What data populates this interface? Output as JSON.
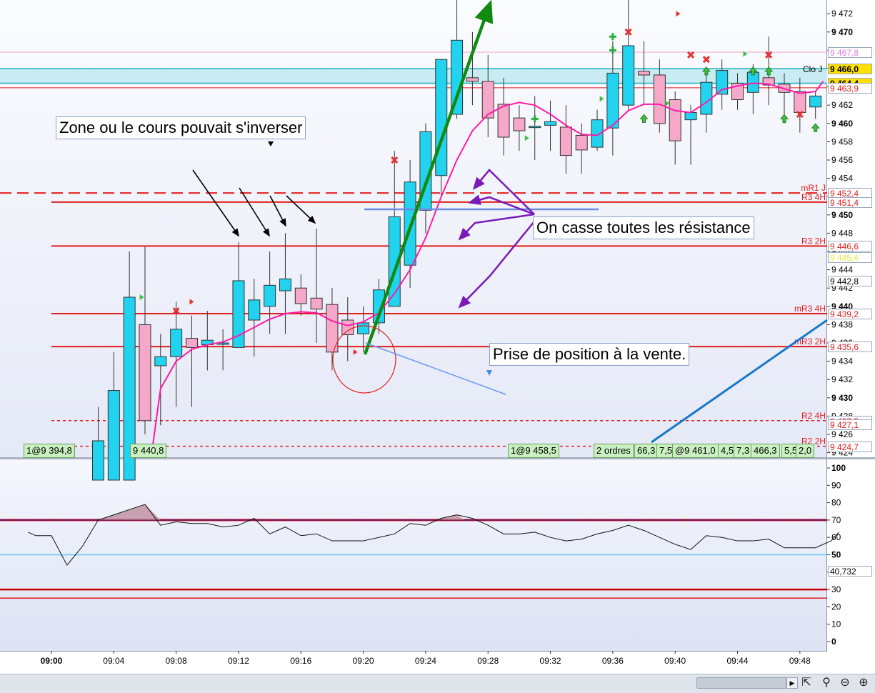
{
  "chart_data": [
    {
      "type": "candlestick",
      "panel": "price",
      "y_ticks": [
        "9 472",
        "9 470",
        "9 468",
        "9 466",
        "9 464",
        "9 462",
        "9 460",
        "9 458",
        "9 456",
        "9 454",
        "9 452",
        "9 450",
        "9 448",
        "9 446",
        "9 444",
        "9 442",
        "9 440",
        "9 438",
        "9 436",
        "9 434",
        "9 432",
        "9 430",
        "9 428",
        "9 426",
        "9 424"
      ],
      "bold_ticks": [
        9470,
        9460,
        9450,
        9440,
        9430
      ],
      "ylim": [
        9423.5,
        9473.5
      ],
      "x_ticks": [
        "09:00",
        "09:04",
        "09:08",
        "09:12",
        "09:16",
        "09:20",
        "09:24",
        "09:28",
        "09:32",
        "09:36",
        "09:40",
        "09:44",
        "09:48"
      ],
      "candles": [
        {
          "t": "09:03",
          "o": 9421.0,
          "h": 9429.0,
          "l": 9421.0,
          "c": 9425.3
        },
        {
          "t": "09:04",
          "o": 9421.0,
          "h": 9435.0,
          "l": 9421.0,
          "c": 9430.8
        },
        {
          "t": "09:05",
          "o": 9421.0,
          "h": 9446.0,
          "l": 9421.0,
          "c": 9441.0
        },
        {
          "t": "09:06",
          "o": 9438.0,
          "h": 9446.5,
          "l": 9426.0,
          "c": 9427.5
        },
        {
          "t": "09:07",
          "o": 9433.5,
          "h": 9437.0,
          "l": 9427.0,
          "c": 9434.5
        },
        {
          "t": "09:08",
          "o": 9434.5,
          "h": 9440.5,
          "l": 9429.0,
          "c": 9437.5
        },
        {
          "t": "09:09",
          "o": 9436.5,
          "h": 9439.0,
          "l": 9429.0,
          "c": 9435.5
        },
        {
          "t": "09:10",
          "o": 9435.8,
          "h": 9439.5,
          "l": 9433.0,
          "c": 9436.3
        },
        {
          "t": "09:11",
          "o": 9436.0,
          "h": 9437.5,
          "l": 9433.0,
          "c": 9436.0
        },
        {
          "t": "09:12",
          "o": 9435.5,
          "h": 9447.0,
          "l": 9435.5,
          "c": 9442.8
        },
        {
          "t": "09:13",
          "o": 9438.5,
          "h": 9443.0,
          "l": 9434.5,
          "c": 9440.7
        },
        {
          "t": "09:14",
          "o": 9440.0,
          "h": 9446.0,
          "l": 9437.0,
          "c": 9442.3
        },
        {
          "t": "09:15",
          "o": 9441.7,
          "h": 9448.0,
          "l": 9437.0,
          "c": 9443.0
        },
        {
          "t": "09:16",
          "o": 9442.0,
          "h": 9443.5,
          "l": 9439.0,
          "c": 9440.3
        },
        {
          "t": "09:17",
          "o": 9440.9,
          "h": 9448.5,
          "l": 9436.0,
          "c": 9439.7
        },
        {
          "t": "09:18",
          "o": 9440.2,
          "h": 9442.0,
          "l": 9433.0,
          "c": 9435.0
        },
        {
          "t": "09:19",
          "o": 9438.5,
          "h": 9441.0,
          "l": 9434.0,
          "c": 9436.9
        },
        {
          "t": "09:20",
          "o": 9437.0,
          "h": 9440.0,
          "l": 9435.0,
          "c": 9438.2
        },
        {
          "t": "09:21",
          "o": 9438.2,
          "h": 9443.0,
          "l": 9437.0,
          "c": 9441.8
        },
        {
          "t": "09:22",
          "o": 9440.0,
          "h": 9457.0,
          "l": 9440.0,
          "c": 9449.8
        },
        {
          "t": "09:23",
          "o": 9444.5,
          "h": 9456.0,
          "l": 9442.0,
          "c": 9453.6
        },
        {
          "t": "09:24",
          "o": 9450.5,
          "h": 9460.0,
          "l": 9448.0,
          "c": 9459.1
        },
        {
          "t": "09:25",
          "o": 9454.3,
          "h": 9466.0,
          "l": 9452.0,
          "c": 9467.0
        },
        {
          "t": "09:26",
          "o": 9461.0,
          "h": 9476.0,
          "l": 9460.5,
          "c": 9469.1
        },
        {
          "t": "09:27",
          "o": 9465.0,
          "h": 9470.0,
          "l": 9462.0,
          "c": 9464.6
        },
        {
          "t": "09:28",
          "o": 9464.6,
          "h": 9467.5,
          "l": 9458.5,
          "c": 9460.6
        },
        {
          "t": "09:29",
          "o": 9462.1,
          "h": 9465.0,
          "l": 9456.5,
          "c": 9458.5
        },
        {
          "t": "09:30",
          "o": 9460.6,
          "h": 9462.0,
          "l": 9457.0,
          "c": 9459.2
        },
        {
          "t": "09:31",
          "o": 9459.7,
          "h": 9463.0,
          "l": 9456.0,
          "c": 9459.7
        },
        {
          "t": "09:32",
          "o": 9459.8,
          "h": 9462.5,
          "l": 9457.0,
          "c": 9460.2
        },
        {
          "t": "09:33",
          "o": 9459.6,
          "h": 9462.0,
          "l": 9454.5,
          "c": 9456.5
        },
        {
          "t": "09:34",
          "o": 9458.7,
          "h": 9460.0,
          "l": 9454.5,
          "c": 9457.1
        },
        {
          "t": "09:35",
          "o": 9457.4,
          "h": 9461.5,
          "l": 9457.0,
          "c": 9460.4
        },
        {
          "t": "09:36",
          "o": 9459.5,
          "h": 9469.0,
          "l": 9456.5,
          "c": 9465.5
        },
        {
          "t": "09:37",
          "o": 9462.0,
          "h": 9474.0,
          "l": 9461.5,
          "c": 9468.5
        },
        {
          "t": "09:38",
          "o": 9465.7,
          "h": 9469.0,
          "l": 9462.0,
          "c": 9465.3
        },
        {
          "t": "09:39",
          "o": 9465.3,
          "h": 9467.0,
          "l": 9459.0,
          "c": 9460.0
        },
        {
          "t": "09:40",
          "o": 9462.6,
          "h": 9463.5,
          "l": 9455.5,
          "c": 9458.1
        },
        {
          "t": "09:41",
          "o": 9460.4,
          "h": 9462.0,
          "l": 9455.5,
          "c": 9461.2
        },
        {
          "t": "09:42",
          "o": 9461.0,
          "h": 9466.0,
          "l": 9459.0,
          "c": 9464.5
        },
        {
          "t": "09:43",
          "o": 9463.2,
          "h": 9467.0,
          "l": 9461.5,
          "c": 9465.8
        },
        {
          "t": "09:44",
          "o": 9464.4,
          "h": 9465.5,
          "l": 9461.5,
          "c": 9462.6
        },
        {
          "t": "09:45",
          "o": 9463.4,
          "h": 9466.5,
          "l": 9461.0,
          "c": 9465.6
        },
        {
          "t": "09:46",
          "o": 9465.0,
          "h": 9469.5,
          "l": 9462.0,
          "c": 9464.2
        },
        {
          "t": "09:47",
          "o": 9464.3,
          "h": 9465.5,
          "l": 9460.0,
          "c": 9463.4
        },
        {
          "t": "09:48",
          "o": 9463.5,
          "h": 9465.0,
          "l": 9459.0,
          "c": 9461.2
        },
        {
          "t": "09:49",
          "o": 9461.8,
          "h": 9463.5,
          "l": 9460.5,
          "c": 9463.0
        }
      ],
      "moving_average": [
        {
          "t": "09:06.5",
          "v": 9424.8
        },
        {
          "t": "09:07",
          "v": 9431.0
        },
        {
          "t": "09:08",
          "v": 9434.0
        },
        {
          "t": "09:09",
          "v": 9435.3
        },
        {
          "t": "09:10",
          "v": 9435.8
        },
        {
          "t": "09:11",
          "v": 9436.1
        },
        {
          "t": "09:12",
          "v": 9436.8
        },
        {
          "t": "09:13",
          "v": 9437.7
        },
        {
          "t": "09:14",
          "v": 9438.6
        },
        {
          "t": "09:15",
          "v": 9439.2
        },
        {
          "t": "09:16",
          "v": 9439.4
        },
        {
          "t": "09:17",
          "v": 9439.3
        },
        {
          "t": "09:18",
          "v": 9438.4
        },
        {
          "t": "09:19",
          "v": 9437.9
        },
        {
          "t": "09:20",
          "v": 9438.3
        },
        {
          "t": "09:21",
          "v": 9439.3
        },
        {
          "t": "09:22",
          "v": 9441.4
        },
        {
          "t": "09:23",
          "v": 9444.0
        },
        {
          "t": "09:24",
          "v": 9447.5
        },
        {
          "t": "09:25",
          "v": 9452.0
        },
        {
          "t": "09:26",
          "v": 9456.0
        },
        {
          "t": "09:27",
          "v": 9459.2
        },
        {
          "t": "09:28",
          "v": 9461.0
        },
        {
          "t": "09:29",
          "v": 9461.9
        },
        {
          "t": "09:30",
          "v": 9462.3
        },
        {
          "t": "09:31",
          "v": 9462.0
        },
        {
          "t": "09:32",
          "v": 9461.0
        },
        {
          "t": "09:33",
          "v": 9459.8
        },
        {
          "t": "09:34",
          "v": 9458.8
        },
        {
          "t": "09:35",
          "v": 9458.7
        },
        {
          "t": "09:36",
          "v": 9459.8
        },
        {
          "t": "09:37",
          "v": 9461.4
        },
        {
          "t": "09:38",
          "v": 9462.1
        },
        {
          "t": "09:39",
          "v": 9462.1
        },
        {
          "t": "09:40",
          "v": 9461.4
        },
        {
          "t": "09:41",
          "v": 9461.2
        },
        {
          "t": "09:42",
          "v": 9462.3
        },
        {
          "t": "09:43",
          "v": 9463.7
        },
        {
          "t": "09:44",
          "v": 9464.1
        },
        {
          "t": "09:45",
          "v": 9464.4
        },
        {
          "t": "09:46",
          "v": 9464.3
        },
        {
          "t": "09:47",
          "v": 9463.8
        },
        {
          "t": "09:48",
          "v": 9463.3
        },
        {
          "t": "09:49",
          "v": 9463.5
        },
        {
          "t": "09:49.5",
          "v": 9464.6
        }
      ],
      "levels": [
        {
          "label": "mR1 J",
          "tag": "9 452,4",
          "value": 9452.4,
          "style": "dashed",
          "color": "#e41c1c"
        },
        {
          "label": "R3 4H",
          "tag": "9 451,4",
          "value": 9451.4,
          "style": "solid",
          "color": "#e41c1c"
        },
        {
          "label": "R3 2H",
          "tag": "9 446,6",
          "value": 9446.6,
          "style": "solid",
          "color": "#e41c1c"
        },
        {
          "label": "mR3 4H",
          "tag": "9 439,2",
          "value": 9439.2,
          "style": "solid",
          "color": "#e41c1c"
        },
        {
          "label": "mR3 2H",
          "tag": "9 435,6",
          "value": 9435.6,
          "style": "solid",
          "color": "#e41c1c"
        },
        {
          "label": "R2 4H",
          "tag": "9 427,5",
          "value": 9427.5,
          "style": "dotted",
          "color": "#e41c1c"
        },
        {
          "label": "R2 2H",
          "tag": "9 424,7",
          "value": 9424.7,
          "style": "dotted",
          "color": "#e41c1c"
        },
        {
          "label": "",
          "tag": "9 427,1",
          "value": 9427.1,
          "style": "none",
          "color": "#e41c1c"
        }
      ],
      "top_bands": [
        {
          "label": "Clo J",
          "tag": "9 466,0",
          "value": 9466.0,
          "color": "#20b0c0",
          "tag_bg": "#ffe000"
        },
        {
          "label": "",
          "tag": "9 464,4",
          "value": 9464.4,
          "color": "#20b0c0",
          "tag_bg": "#ffe000"
        },
        {
          "label": "",
          "tag": "9 463,9",
          "value": 9463.9,
          "color": "#e41c1c",
          "tag_bg": "#ffffff"
        },
        {
          "label": "",
          "tag": "9 467,8",
          "value": 9467.8,
          "color": "#e080e0",
          "tag_bg": "#ffffff"
        },
        {
          "label": "",
          "tag": "9 445,4",
          "value": 9445.4,
          "color": "#e8e840",
          "tag_bg": "#ffffff"
        },
        {
          "label": "",
          "tag": "9 442,8",
          "value": 9442.8,
          "color": "#555555",
          "tag_bg": "#ffffff"
        }
      ],
      "annotations": [
        {
          "key": "zone",
          "text": "Zone ou le cours pouvait s'inverser"
        },
        {
          "key": "casse",
          "text": "On casse toutes les résistance"
        },
        {
          "key": "vente",
          "text": "Prise de position à la vente."
        }
      ],
      "order_boxes": [
        {
          "text": "1@9 394,8"
        },
        {
          "text": "9 440,8"
        },
        {
          "text": "1@9 458,5"
        },
        {
          "text": "2 ordres"
        },
        {
          "text": "66,3"
        },
        {
          "text": "7,5"
        },
        {
          "text": "@9 461,0"
        },
        {
          "text": "4,5"
        },
        {
          "text": "7,3"
        },
        {
          "text": "466,3"
        },
        {
          "text": "5,5"
        },
        {
          "text": "2,0"
        }
      ]
    },
    {
      "type": "line",
      "panel": "oscillator",
      "y_ticks": [
        "100",
        "90",
        "80",
        "70",
        "60",
        "50",
        "40",
        "30",
        "20",
        "10",
        "0"
      ],
      "bold_ticks": [
        100,
        50,
        0
      ],
      "ylim": [
        0,
        100
      ],
      "current_value": "40,732",
      "reference_lines": [
        {
          "value": 70,
          "color": "#1a3ad8",
          "style": "red-blue"
        },
        {
          "value": 50,
          "color": "#60c8f0",
          "style": "solid"
        },
        {
          "value": 30,
          "color": "#cc0000",
          "style": "solid"
        },
        {
          "value": 25,
          "color": "#e41c1c",
          "style": "solid"
        }
      ],
      "series": [
        {
          "values": [
            {
              "t": "08:58.5",
              "v": 63
            },
            {
              "t": "08:59",
              "v": 61
            },
            {
              "t": "09:00",
              "v": 61
            },
            {
              "t": "09:01",
              "v": 44
            },
            {
              "t": "09:02",
              "v": 55
            },
            {
              "t": "09:03",
              "v": 70
            },
            {
              "t": "09:04",
              "v": 73
            },
            {
              "t": "09:05",
              "v": 76
            },
            {
              "t": "09:06",
              "v": 79
            },
            {
              "t": "09:07",
              "v": 67
            },
            {
              "t": "09:08",
              "v": 69
            },
            {
              "t": "09:09",
              "v": 68
            },
            {
              "t": "09:10",
              "v": 68
            },
            {
              "t": "09:11",
              "v": 66
            },
            {
              "t": "09:12",
              "v": 67
            },
            {
              "t": "09:13",
              "v": 71
            },
            {
              "t": "09:14",
              "v": 62
            },
            {
              "t": "09:15",
              "v": 66
            },
            {
              "t": "09:16",
              "v": 61
            },
            {
              "t": "09:17",
              "v": 62
            },
            {
              "t": "09:18",
              "v": 58
            },
            {
              "t": "09:19",
              "v": 58
            },
            {
              "t": "09:20",
              "v": 58
            },
            {
              "t": "09:21",
              "v": 60
            },
            {
              "t": "09:22",
              "v": 62
            },
            {
              "t": "09:23",
              "v": 68
            },
            {
              "t": "09:24",
              "v": 67
            },
            {
              "t": "09:25",
              "v": 71
            },
            {
              "t": "09:26",
              "v": 73
            },
            {
              "t": "09:27",
              "v": 71
            },
            {
              "t": "09:28",
              "v": 67
            },
            {
              "t": "09:29",
              "v": 62
            },
            {
              "t": "09:30",
              "v": 62
            },
            {
              "t": "09:31",
              "v": 63
            },
            {
              "t": "09:32",
              "v": 60
            },
            {
              "t": "09:33",
              "v": 58
            },
            {
              "t": "09:34",
              "v": 59
            },
            {
              "t": "09:35",
              "v": 62
            },
            {
              "t": "09:36",
              "v": 64
            },
            {
              "t": "09:37",
              "v": 67
            },
            {
              "t": "09:38",
              "v": 64
            },
            {
              "t": "09:39",
              "v": 60
            },
            {
              "t": "09:40",
              "v": 56
            },
            {
              "t": "09:41",
              "v": 53
            },
            {
              "t": "09:42",
              "v": 61
            },
            {
              "t": "09:43",
              "v": 60
            },
            {
              "t": "09:44",
              "v": 58
            },
            {
              "t": "09:45",
              "v": 58
            },
            {
              "t": "09:46",
              "v": 59
            },
            {
              "t": "09:47",
              "v": 54
            },
            {
              "t": "09:48",
              "v": 54
            },
            {
              "t": "09:49",
              "v": 54
            },
            {
              "t": "09:50",
              "v": 58
            },
            {
              "t": "09:50.5",
              "v": 63
            }
          ]
        }
      ]
    }
  ],
  "theme": {
    "bull_color": "#22d3f0",
    "bear_color": "#f6a8c8",
    "ma_color": "#ff1aa8",
    "level_color": "#e41c1c",
    "trend_up_color": "#108a10",
    "trend_blue_color": "#1a78c8",
    "arrow_purple": "#7a1ab8",
    "panel_bg_top": "#f4f6fc",
    "panel_bg_bottom": "#dfe4f4"
  },
  "toolbar": {
    "scroll_right_icon": "triangle-right-icon",
    "tools": [
      "pointer-icon",
      "zoom-fit-icon",
      "zoom-out-icon",
      "zoom-in-icon"
    ]
  }
}
